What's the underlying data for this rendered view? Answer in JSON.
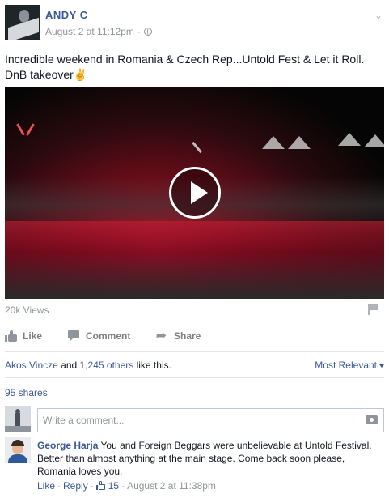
{
  "post": {
    "author": "ANDY C",
    "timestamp": "August 2 at 11:12pm",
    "separator": "·",
    "privacy_icon": "globe-icon",
    "menu_icon": "chevron-down-icon",
    "text": "Incredible weekend in Romania & Czech Rep...Untold Fest & Let it Roll. DnB takeover",
    "text_emoji": "✌"
  },
  "video": {
    "play_icon": "play-icon",
    "views": "20k Views",
    "report_icon": "flag-icon"
  },
  "actions": {
    "like": "Like",
    "comment": "Comment",
    "share": "Share"
  },
  "reactions": {
    "first_liker": "Akos Vincze",
    "and": "and",
    "others": "1,245 others",
    "suffix": "like this.",
    "sort_label": "Most Relevant"
  },
  "shares": "95 shares",
  "composer": {
    "placeholder": "Write a comment...",
    "camera_icon": "camera-icon"
  },
  "comment": {
    "author": "George Harja",
    "text": "You and Foreign Beggars were unbelievable at Untold Festival. Better than almost anything at the main stage. Come back soon please, Romania loves you.",
    "like_label": "Like",
    "reply_label": "Reply",
    "sep": "·",
    "like_count": "15",
    "timestamp": "August 2 at 11:38pm"
  },
  "colors": {
    "link": "#3b5998",
    "muted": "#90949c",
    "text": "#141823"
  }
}
